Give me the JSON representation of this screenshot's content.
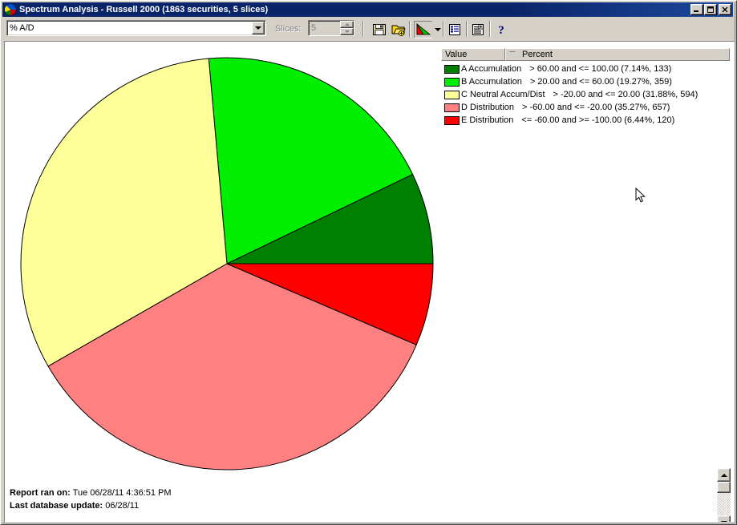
{
  "window": {
    "title": "Spectrum Analysis - Russell 2000 (1863 securities, 5 slices)",
    "icon": "pie-chart-icon",
    "minimize_label": "_",
    "maximize_label": "□",
    "close_label": "✕"
  },
  "toolbar": {
    "combo_value": "% A/D",
    "combo_placeholder": "% A/D",
    "slices_label": "Slices:",
    "slices_value": "5",
    "buttons": [
      {
        "name": "save-button",
        "icon": "floppy-disk-icon",
        "label": "Save"
      },
      {
        "name": "open-button",
        "icon": "open-folder-add-icon",
        "label": "Open"
      },
      {
        "name": "pie-chart-view-button",
        "icon": "pie-chart-icon",
        "label": "Pie Chart View"
      },
      {
        "name": "chart-type-dropdown-button",
        "icon": "chevron-down-icon",
        "label": "Chart Type"
      },
      {
        "name": "list-report-button",
        "icon": "list-report-icon",
        "label": "Report"
      },
      {
        "name": "detail-report-button",
        "icon": "detail-report-add-icon",
        "label": "Detail Report"
      },
      {
        "name": "help-button",
        "icon": "question-mark-icon",
        "label": "Help"
      }
    ]
  },
  "legend": {
    "header": {
      "value": "Value",
      "percent": "Percent",
      "sort_indicator": "descending"
    }
  },
  "footer": {
    "report_ran_label": "Report ran on:",
    "report_ran_value": "Tue 06/28/11 4:36:51 PM",
    "last_update_label": "Last database update:",
    "last_update_value": "06/28/11"
  },
  "scrollbar": {
    "up_label": "▲",
    "down_label": "▼"
  },
  "chart_data": {
    "type": "pie",
    "title": "Spectrum Analysis - Russell 2000",
    "subtitle": "1863 securities, 5 slices",
    "metric": "% A/D",
    "total_securities": 1863,
    "slice_count": 5,
    "start_angle_deg": 0,
    "direction": "counterclockwise",
    "categories": [
      "A Accumulation",
      "B Accumulation",
      "C Neutral Accum/Dist",
      "D Distribution",
      "E Distribution"
    ],
    "values": [
      7.14,
      19.27,
      31.88,
      35.27,
      6.44
    ],
    "counts": [
      133,
      359,
      594,
      657,
      120
    ],
    "colors": [
      "#008000",
      "#00ee00",
      "#ffff99",
      "#ff8080",
      "#ff0000"
    ],
    "ranges": [
      "> 60.00 and <= 100.00",
      "> 20.00 and <= 60.00",
      "> -20.00 and <= 20.00",
      "> -60.00 and <= -20.00",
      "<= -60.00 and >= -100.00"
    ],
    "slices": [
      {
        "label": "A Accumulation",
        "range": "> 60.00 and <= 100.00",
        "percent": 7.14,
        "count": 133,
        "color": "#008000",
        "legend_text": "A Accumulation   > 60.00 and <= 100.00 (7.14%, 133)"
      },
      {
        "label": "B Accumulation",
        "range": "> 20.00 and <= 60.00",
        "percent": 19.27,
        "count": 359,
        "color": "#00ee00",
        "legend_text": "B Accumulation   > 20.00 and <= 60.00 (19.27%, 359)"
      },
      {
        "label": "C Neutral Accum/Dist",
        "range": "> -20.00 and <= 20.00",
        "percent": 31.88,
        "count": 594,
        "color": "#ffff99",
        "legend_text": "C Neutral Accum/Dist   > -20.00 and <= 20.00 (31.88%, 594)"
      },
      {
        "label": "D Distribution",
        "range": "> -60.00 and <= -20.00",
        "percent": 35.27,
        "count": 657,
        "color": "#ff8080",
        "legend_text": "D Distribution   > -60.00 and <= -20.00 (35.27%, 657)"
      },
      {
        "label": "E Distribution",
        "range": "<= -60.00 and >= -100.00",
        "percent": 6.44,
        "count": 120,
        "color": "#ff0000",
        "legend_text": "E Distribution   <= -60.00 and >= -100.00 (6.44%, 120)"
      }
    ],
    "xlabel": "",
    "ylabel": "",
    "legend_position": "right"
  }
}
